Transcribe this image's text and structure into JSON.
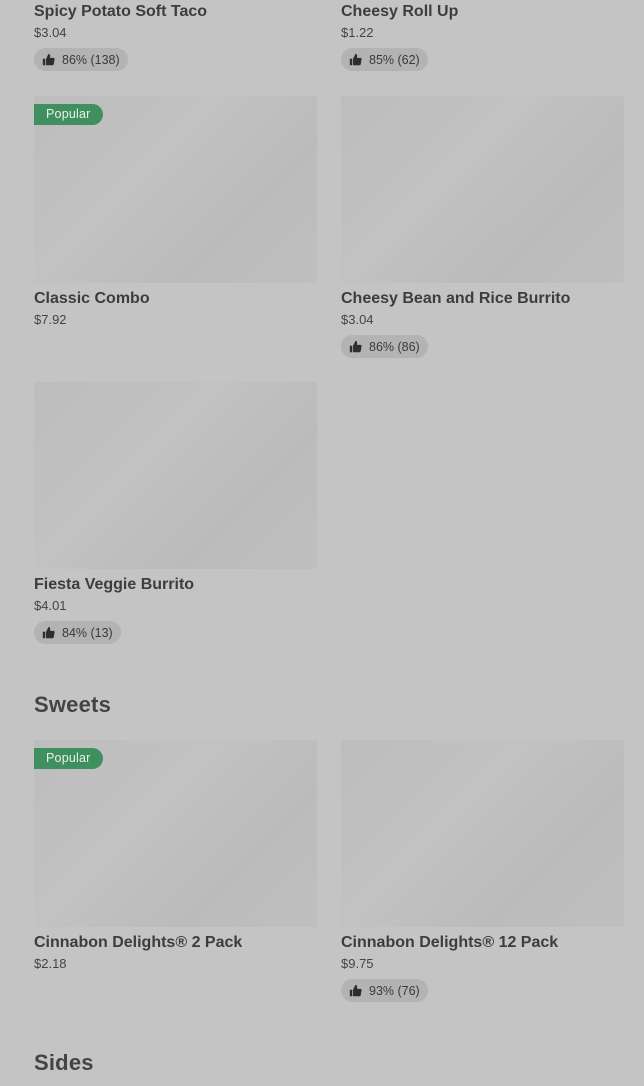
{
  "top_items": [
    {
      "name": "Spicy Potato Soft Taco",
      "price": "$3.04",
      "rating": "86% (138)"
    },
    {
      "name": "Cheesy Roll Up",
      "price": "$1.22",
      "rating": "85% (62)"
    }
  ],
  "group1": [
    {
      "badge": "Popular",
      "name": "Classic Combo",
      "price": "$7.92"
    },
    {
      "name": "Cheesy Bean and Rice Burrito",
      "price": "$3.04",
      "rating": "86% (86)"
    },
    {
      "name": "Fiesta Veggie Burrito",
      "price": "$4.01",
      "rating": "84% (13)"
    }
  ],
  "sweets": {
    "title": "Sweets",
    "items": [
      {
        "badge": "Popular",
        "name": "Cinnabon Delights® 2 Pack",
        "price": "$2.18"
      },
      {
        "name": "Cinnabon Delights® 12 Pack",
        "price": "$9.75",
        "rating": "93% (76)"
      }
    ]
  },
  "sides": {
    "title": "Sides"
  },
  "icons": {
    "rating": "thumbs-up-icon"
  },
  "colors": {
    "background": "#c4c4c4",
    "popular_badge": "#3f8f5f",
    "rating_pill": "#b3b3b3"
  }
}
